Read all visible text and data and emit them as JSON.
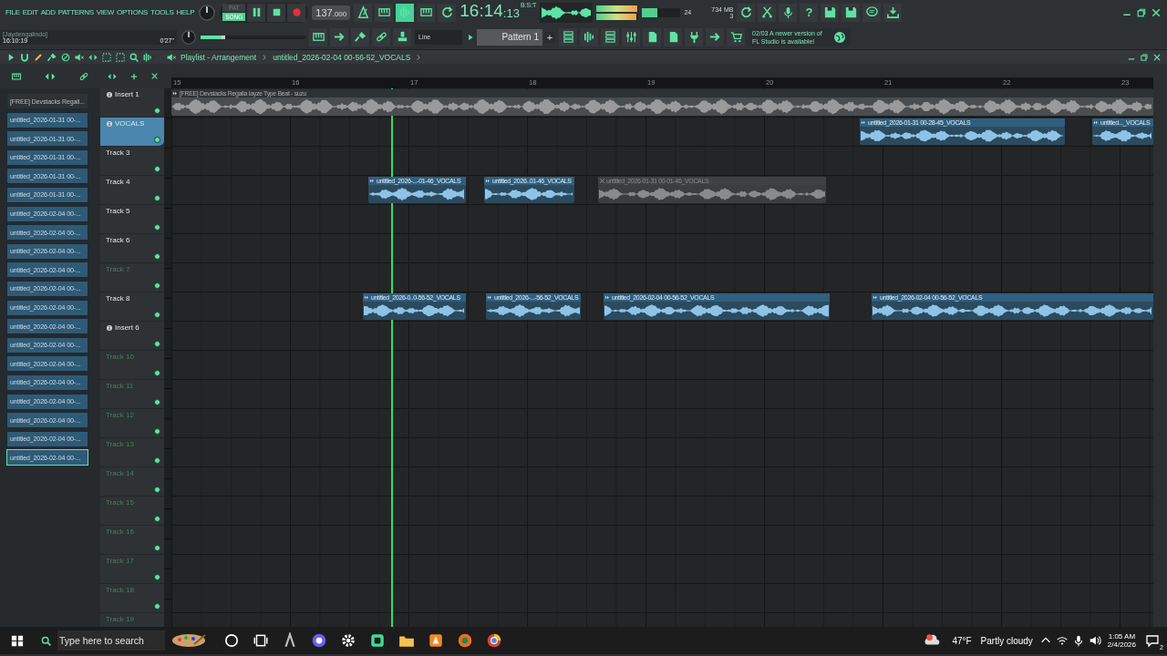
{
  "menu": [
    "FILE",
    "EDIT",
    "ADD",
    "PATTERNS",
    "VIEW",
    "OPTIONS",
    "TOOLS",
    "HELP"
  ],
  "hint_panel": {
    "user": "[Jaydengalindo]",
    "time": "16:10:19",
    "length": "0'27\""
  },
  "transport": {
    "modes": [
      {
        "label": "PAT",
        "selected": false
      },
      {
        "label": "SONG",
        "selected": true
      }
    ]
  },
  "tempo": {
    "whole": "137",
    "fraction": ".000"
  },
  "toolbar_toggles": [
    {
      "on": false
    },
    {
      "on": false
    },
    {
      "on": true
    },
    {
      "on": false
    },
    {
      "on": false
    }
  ],
  "song_time": {
    "main": "16:14",
    "sub": ":13",
    "unit": "B:S:T"
  },
  "master_meter": [
    {
      "level": 0.97
    },
    {
      "level": 0.95
    }
  ],
  "cpu_meter": {
    "level": 0.4,
    "polyphony": "24",
    "memory": "734 MB",
    "voices": "3"
  },
  "master_volume": {
    "level": 0.2
  },
  "snap": {
    "value": "Line"
  },
  "pattern": {
    "value": "Pattern 1",
    "add": "+"
  },
  "help": {
    "label": "?"
  },
  "news": {
    "date": "02/03",
    "message": "A newer version of FL Studio is available!"
  },
  "playlist": {
    "title": "Playlist - Arrangement",
    "clip_name": "untitled_2026-02-04 00-56-52_VOCALS",
    "ruler": [
      "15",
      "16",
      "17",
      "18",
      "19",
      "20",
      "21",
      "22",
      "23"
    ],
    "picker": [
      {
        "label": "[FREE] Devstacks  Regali...",
        "kind": "beat",
        "selected": false
      },
      {
        "label": "untitled_2026-01-31 00-...",
        "kind": "audio",
        "selected": false
      },
      {
        "label": "untitled_2026-01-31 00-...",
        "kind": "audio",
        "selected": false
      },
      {
        "label": "untitled_2026-01-31 00-...",
        "kind": "audio",
        "selected": false
      },
      {
        "label": "untitled_2026-01-31 00-...",
        "kind": "audio",
        "selected": false
      },
      {
        "label": "untitled_2026-01-31 00-...",
        "kind": "audio",
        "selected": false
      },
      {
        "label": "untitled_2026-02-04 00-...",
        "kind": "audio",
        "selected": false
      },
      {
        "label": "untitled_2026-02-04 00-...",
        "kind": "audio",
        "selected": false
      },
      {
        "label": "untitled_2026-02-04 00-...",
        "kind": "audio",
        "selected": false
      },
      {
        "label": "untitled_2026-02-04 00-...",
        "kind": "audio",
        "selected": false
      },
      {
        "label": "untitled_2026-02-04 00-...",
        "kind": "audio",
        "selected": false
      },
      {
        "label": "untitled_2026-02-04 00-...",
        "kind": "audio",
        "selected": false
      },
      {
        "label": "untitled_2026-02-04 00-...",
        "kind": "audio",
        "selected": false
      },
      {
        "label": "untitled_2026-02-04 00-...",
        "kind": "audio",
        "selected": false
      },
      {
        "label": "untitled_2026-02-04 00-...",
        "kind": "audio",
        "selected": false
      },
      {
        "label": "untitled_2026-02-04 00-...",
        "kind": "audio",
        "selected": false
      },
      {
        "label": "untitled_2026-02-04 00-...",
        "kind": "audio",
        "selected": false
      },
      {
        "label": "untitled_2026-02-04 00-...",
        "kind": "audio",
        "selected": false
      },
      {
        "label": "untitled_2026-02-04 00-...",
        "kind": "audio",
        "selected": false
      },
      {
        "label": "untitled_2026-02-04 00-...",
        "kind": "audio",
        "selected": true
      }
    ],
    "tracks": [
      {
        "name": "Insert 1",
        "routed": true,
        "selected": false,
        "active": true,
        "clips": [
          {
            "kind": "beat",
            "name": "[FREE] Devstacks  Regalia  Iayze Type Beat - suzu",
            "muted": false
          }
        ]
      },
      {
        "name": "VOCALS",
        "routed": true,
        "selected": true,
        "active": true,
        "clips": [
          {
            "kind": "audio",
            "name": "untitled_2026-01-31 00-28-45_VOCALS",
            "muted": false
          },
          {
            "kind": "audio",
            "name": "untitled..._VOCALS",
            "muted": false
          }
        ]
      },
      {
        "name": "Track 3",
        "routed": false,
        "selected": false,
        "active": true
      },
      {
        "name": "Track 4",
        "routed": false,
        "selected": false,
        "active": true,
        "clips": [
          {
            "kind": "audio",
            "name": "untitled_2026-...-01-46_VOCALS",
            "muted": false
          },
          {
            "kind": "audio",
            "name": "untitled_2026..01-46_VOCALS",
            "muted": false
          },
          {
            "kind": "audio",
            "name": "untitled_2026-01-31 00-01-46_VOCALS",
            "muted": true
          }
        ]
      },
      {
        "name": "Track 5",
        "routed": false,
        "selected": false,
        "active": true
      },
      {
        "name": "Track 6",
        "routed": false,
        "selected": false,
        "active": true
      },
      {
        "name": "Track 7",
        "routed": false,
        "selected": false,
        "active": false
      },
      {
        "name": "Track 8",
        "routed": false,
        "selected": false,
        "active": true,
        "clips": [
          {
            "kind": "audio",
            "name": "untitled_2026-0..0-56-52_VOCALS",
            "muted": false
          },
          {
            "kind": "audio",
            "name": "untitled_2026-...-56-52_VOCALS",
            "muted": false
          },
          {
            "kind": "audio",
            "name": "untitled_2026-02-04 00-56-52_VOCALS",
            "muted": false
          },
          {
            "kind": "audio",
            "name": "untitled_2026-02-04 00-56-52_VOCALS",
            "muted": false
          }
        ]
      },
      {
        "name": "Insert 6",
        "routed": true,
        "selected": false,
        "active": true
      },
      {
        "name": "Track 10",
        "routed": false,
        "selected": false,
        "active": false
      },
      {
        "name": "Track 11",
        "routed": false,
        "selected": false,
        "active": false
      },
      {
        "name": "Track 12",
        "routed": false,
        "selected": false,
        "active": false
      },
      {
        "name": "Track 13",
        "routed": false,
        "selected": false,
        "active": false
      },
      {
        "name": "Track 14",
        "routed": false,
        "selected": false,
        "active": false
      },
      {
        "name": "Track 15",
        "routed": false,
        "selected": false,
        "active": false
      },
      {
        "name": "Track 16",
        "routed": false,
        "selected": false,
        "active": false
      },
      {
        "name": "Track 17",
        "routed": false,
        "selected": false,
        "active": false
      },
      {
        "name": "Track 18",
        "routed": false,
        "selected": false,
        "active": false
      },
      {
        "name": "Track 19",
        "routed": false,
        "selected": false,
        "active": false
      }
    ]
  },
  "taskbar": {
    "search": {
      "placeholder": "Type here to search"
    },
    "weather": {
      "temperature": "47°F",
      "condition": "Partly cloudy"
    },
    "clock": {
      "time": "1:05 AM",
      "date": "2/4/2026"
    },
    "notifications": "2"
  }
}
